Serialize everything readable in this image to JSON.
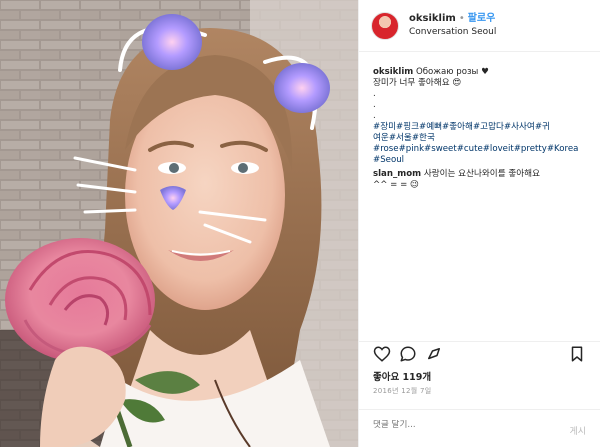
{
  "post": {
    "username": "oksiklim",
    "dot": "•",
    "follow_label": "팔로우",
    "location": "Conversation Seoul"
  },
  "caption": {
    "username": "oksiklim",
    "text": " Обожаю розы ♥",
    "lines": [
      "장미가 너무 좋아해요 😍",
      ".",
      ".",
      "."
    ]
  },
  "hashtags": {
    "row1": [
      "#장미",
      "#핑크",
      "#예뻐",
      "#좋아해",
      "#고맙다",
      "#사사여",
      "#귀"
    ],
    "row2": [
      "여운",
      "#서울",
      "#한국"
    ],
    "row3": [
      "#rose",
      "#pink",
      "#sweet",
      "#cute",
      "#loveit",
      "#pretty",
      "#Korea"
    ],
    "row4": [
      "#Seoul"
    ]
  },
  "comment": {
    "username": "slan_mom",
    "text": " 사랑이는 요산나와이를 좋아해요",
    "line2": "^^ = = 😉"
  },
  "likes_label": "좋아요 119개",
  "date_label": "2016년 12월 7일",
  "add_comment_placeholder": "댓글 달기...",
  "more_label": "게시",
  "icons": {
    "like": "heart-icon",
    "comment": "comment-icon",
    "share": "share-icon",
    "save": "bookmark-icon",
    "location": "location-text"
  },
  "colors": {
    "follow": "#3897f0",
    "hashtag": "#003569",
    "muted": "#999999",
    "divider": "#efefef"
  }
}
